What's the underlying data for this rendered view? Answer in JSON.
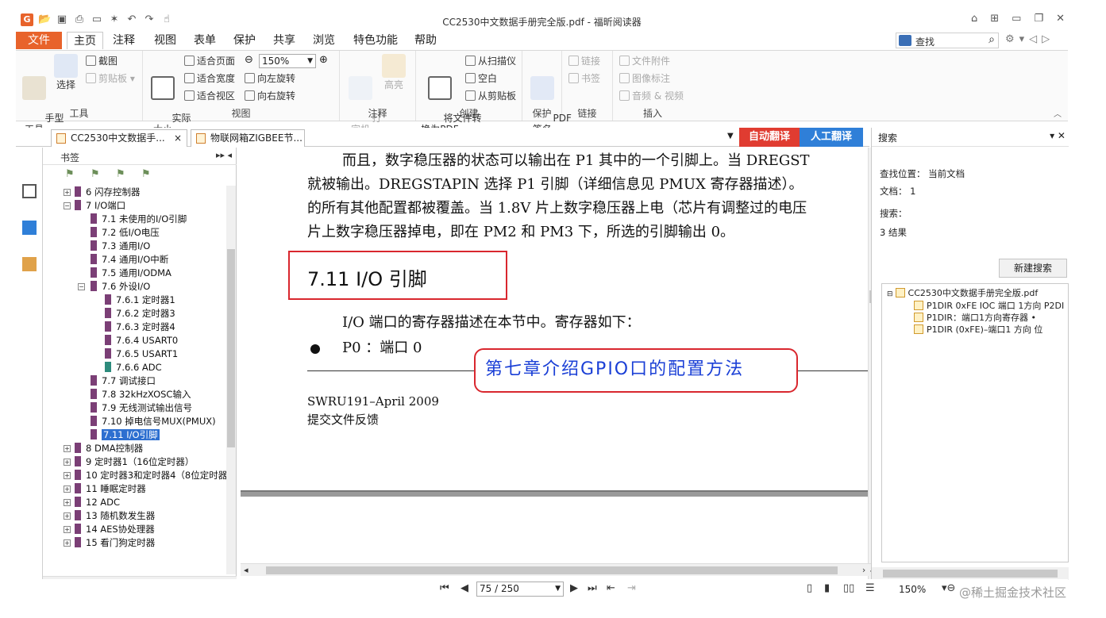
{
  "app": {
    "title": "CC2530中文数据手册完全版.pdf - 福昕阅读器"
  },
  "menu": {
    "file": "文件",
    "tabs": [
      "主页",
      "注释",
      "视图",
      "表单",
      "保护",
      "共享",
      "浏览",
      "特色功能",
      "帮助"
    ],
    "search_label": "查找"
  },
  "ribbon": {
    "tools": {
      "hand": "手型\n工具",
      "select": "选择",
      "screenshot": "截图",
      "clipboard": "剪贴板",
      "label": "工具"
    },
    "view": {
      "actual": "实际\n大小",
      "fit_page": "适合页面",
      "fit_width": "适合宽度",
      "fit_visible": "适合视区",
      "zoom": "150%",
      "rotate_left": "向左旋转",
      "rotate_right": "向右旋转",
      "label": "视图"
    },
    "annot": {
      "typewriter": "打\n字机",
      "highlight": "高亮",
      "label": "注释"
    },
    "create": {
      "convert": "将文件转\n换为PDF",
      "scan": "从扫描仪",
      "blank": "空白",
      "clipboard": "从剪贴板",
      "label": "创建"
    },
    "protect": {
      "sign": "PDF\n签名",
      "label": "保护"
    },
    "links": {
      "link": "链接",
      "bookmark": "书签",
      "label": "链接"
    },
    "insert": {
      "attach": "文件附件",
      "image": "图像标注",
      "av": "音频 & 视频",
      "label": "插入"
    }
  },
  "doc_tabs": [
    {
      "label": "CC2530中文数据手..."
    },
    {
      "label": "物联网箱ZIGBEE节..."
    }
  ],
  "translate": {
    "auto": "自动翻译",
    "human": "人工翻译"
  },
  "bookmarks": {
    "title": "书签",
    "items": [
      {
        "label": "6  闪存控制器"
      },
      {
        "label": "7  I/O端口"
      },
      {
        "label": "7.1  未使用的I/O引脚"
      },
      {
        "label": "7.2  低I/O电压"
      },
      {
        "label": "7.3  通用I/O"
      },
      {
        "label": "7.4  通用I/O中断"
      },
      {
        "label": "7.5  通用I/ODMA"
      },
      {
        "label": "7.6  外设I/O"
      },
      {
        "label": "7.6.1  定时器1"
      },
      {
        "label": "7.6.2  定时器3"
      },
      {
        "label": "7.6.3  定时器4"
      },
      {
        "label": "7.6.4  USART0"
      },
      {
        "label": "7.6.5  USART1"
      },
      {
        "label": "7.6.6  ADC"
      },
      {
        "label": "7.7  调试接口"
      },
      {
        "label": "7.8  32kHzXOSC输入"
      },
      {
        "label": "7.9  无线测试输出信号"
      },
      {
        "label": "7.10  掉电信号MUX(PMUX)"
      },
      {
        "label": "7.11  I/O引脚"
      },
      {
        "label": "8  DMA控制器"
      },
      {
        "label": "9  定时器1（16位定时器）"
      },
      {
        "label": "10  定时器3和定时器4（8位定时器）"
      },
      {
        "label": "11  睡眠定时器"
      },
      {
        "label": "12  ADC"
      },
      {
        "label": "13  随机数发生器"
      },
      {
        "label": "14  AES协处理器"
      },
      {
        "label": "15  看门狗定时器"
      }
    ]
  },
  "document": {
    "lines": [
      "而且，数字稳压器的状态可以输出在 P1 其中的一个引脚上。当 DREGST",
      "就被输出。DREGSTAPIN 选择 P1 引脚（详细信息见 PMUX 寄存器描述）。",
      "的所有其他配置都被覆盖。当 1.8V 片上数字稳压器上电（芯片有调整过的电压",
      "片上数字稳压器掉电，即在 PM2 和 PM3 下，所选的引脚输出 0。"
    ],
    "heading": "7.11   I/O 引脚",
    "para": "I/O 端口的寄存器描述在本节中。寄存器如下：",
    "bullet": "P0 ：端口 0",
    "callout": "第七章介绍GPIO口的配置方法",
    "footer1": "SWRU191–April 2009",
    "footer2": "提交文件反馈"
  },
  "search_panel": {
    "title": "搜索",
    "location": "查找位置：  当前文档",
    "docs": "文档：  1",
    "search_label": "搜索：",
    "results_count": "3 结果",
    "new_search": "新建搜索",
    "root": "CC2530中文数据手册完全版.pdf",
    "results": [
      "P1DIR 0xFE IOC 端口 1方向 P2DI",
      "P1DIR：端口1方向寄存器 •",
      "P1DIR (0xFE)–端口1 方向 位"
    ]
  },
  "status": {
    "page": "75 / 250",
    "zoom": "150%",
    "watermark": "@稀土掘金技术社区"
  },
  "colors": {
    "accent": "#e8632b",
    "auto_translate": "#e03c31",
    "human_translate": "#2f7fd8",
    "callout_border": "#d9272e",
    "callout_text": "#1a3fd6"
  }
}
